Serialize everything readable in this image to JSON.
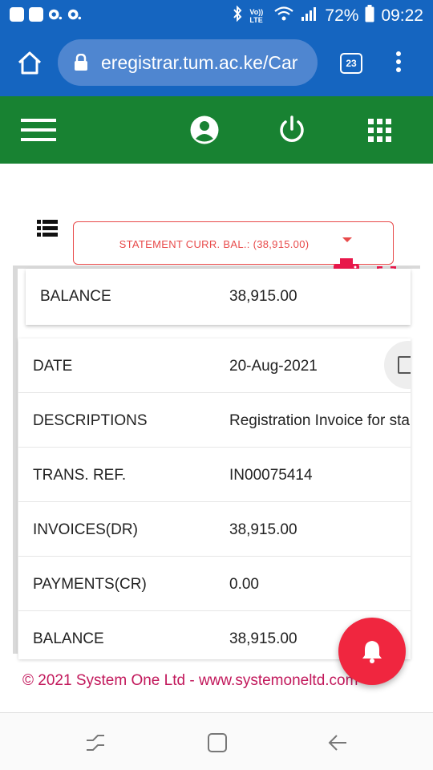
{
  "status_bar": {
    "battery": "72%",
    "time": "09:22",
    "network_label": "Vo)) LTE"
  },
  "browser": {
    "url": "eregistrar.tum.ac.ke/Car",
    "tab_count": "23"
  },
  "statement": {
    "dropdown_label": "STATEMENT CURR. BAL.: (38,915.00)"
  },
  "balance_card": {
    "label": "BALANCE",
    "value": "38,915.00"
  },
  "detail_rows": [
    {
      "label": "DATE",
      "value": "20-Aug-2021"
    },
    {
      "label": "DESCRIPTIONS",
      "value": "Registration Invoice for sta"
    },
    {
      "label": "TRANS. REF.",
      "value": "IN00075414"
    },
    {
      "label": "INVOICES(DR)",
      "value": "38,915.00"
    },
    {
      "label": "PAYMENTS(CR)",
      "value": "0.00"
    },
    {
      "label": "BALANCE",
      "value": "38,915.00"
    }
  ],
  "footer": {
    "text": "© 2021 System One Ltd - www.systemoneltd.com"
  },
  "colors": {
    "browser_blue": "#1565c0",
    "app_green": "#188232",
    "accent_red": "#e84a4a",
    "fab_red": "#f0263f",
    "footer_pink": "#c2185b"
  }
}
